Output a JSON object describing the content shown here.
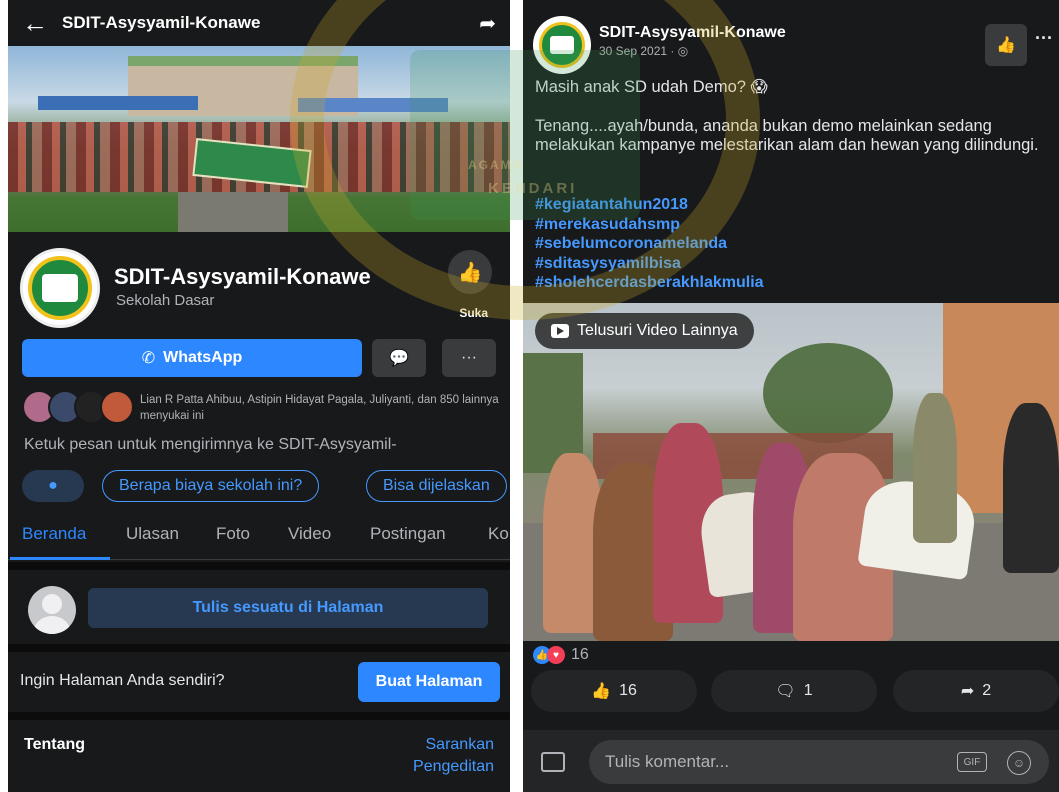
{
  "left": {
    "topbar": {
      "title": "SDIT-Asysyamil-Konawe"
    },
    "profile": {
      "name": "SDIT-Asysyamil-Konawe",
      "category": "Sekolah Dasar",
      "like_label": "Suka"
    },
    "actions": {
      "whatsapp_label": "WhatsApp",
      "more_label": "···"
    },
    "friends": {
      "text": "Lian R Patta Ahibuu, Astipin Hidayat Pagala, Juliyanti, dan 850 lainnya menyukai ini"
    },
    "hint": "Ketuk pesan untuk mengirimnya ke SDIT-Asysyamil-",
    "chips": [
      "Berapa biaya sekolah ini?",
      "Bisa dijelaskan"
    ],
    "tabs": [
      "Beranda",
      "Ulasan",
      "Foto",
      "Video",
      "Postingan",
      "Ko"
    ],
    "composer": {
      "label": "Tulis sesuatu di Halaman"
    },
    "create_page": {
      "question": "Ingin Halaman Anda sendiri?",
      "button": "Buat Halaman"
    },
    "about": {
      "heading": "Tentang",
      "suggest_line1": "Sarankan",
      "suggest_line2": "Pengeditan"
    }
  },
  "right": {
    "post": {
      "author": "SDIT-Asysyamil-Konawe",
      "date": "30 Sep 2021 · ◎",
      "line1": "Masih anak SD udah Demo? 😱",
      "body": "Tenang....ayah/bunda, ananda bukan demo melainkan sedang melakukan kampanye melestarikan alam dan hewan yang dilindungi.",
      "hashtags": [
        "#kegiatantahun2018",
        "#merekasudahsmp",
        "#sebelumcoronamelanda",
        "#sditasysyamilbisa",
        "#sholehcerdasberakhlakmulia"
      ]
    },
    "video": {
      "button": "Telusuri Video Lainnya"
    },
    "reactions": {
      "count": "16"
    },
    "buttons": {
      "like": "16",
      "comment": "1",
      "share": "2"
    },
    "comment": {
      "placeholder": "Tulis komentar...",
      "gif": "GIF"
    }
  },
  "watermark": {
    "line1": "AGAMA",
    "line2": "KENDARI"
  },
  "colors": {
    "background": "#18191a",
    "accent": "#2d88ff",
    "link": "#4599ff",
    "surface": "#3a3b3c"
  }
}
